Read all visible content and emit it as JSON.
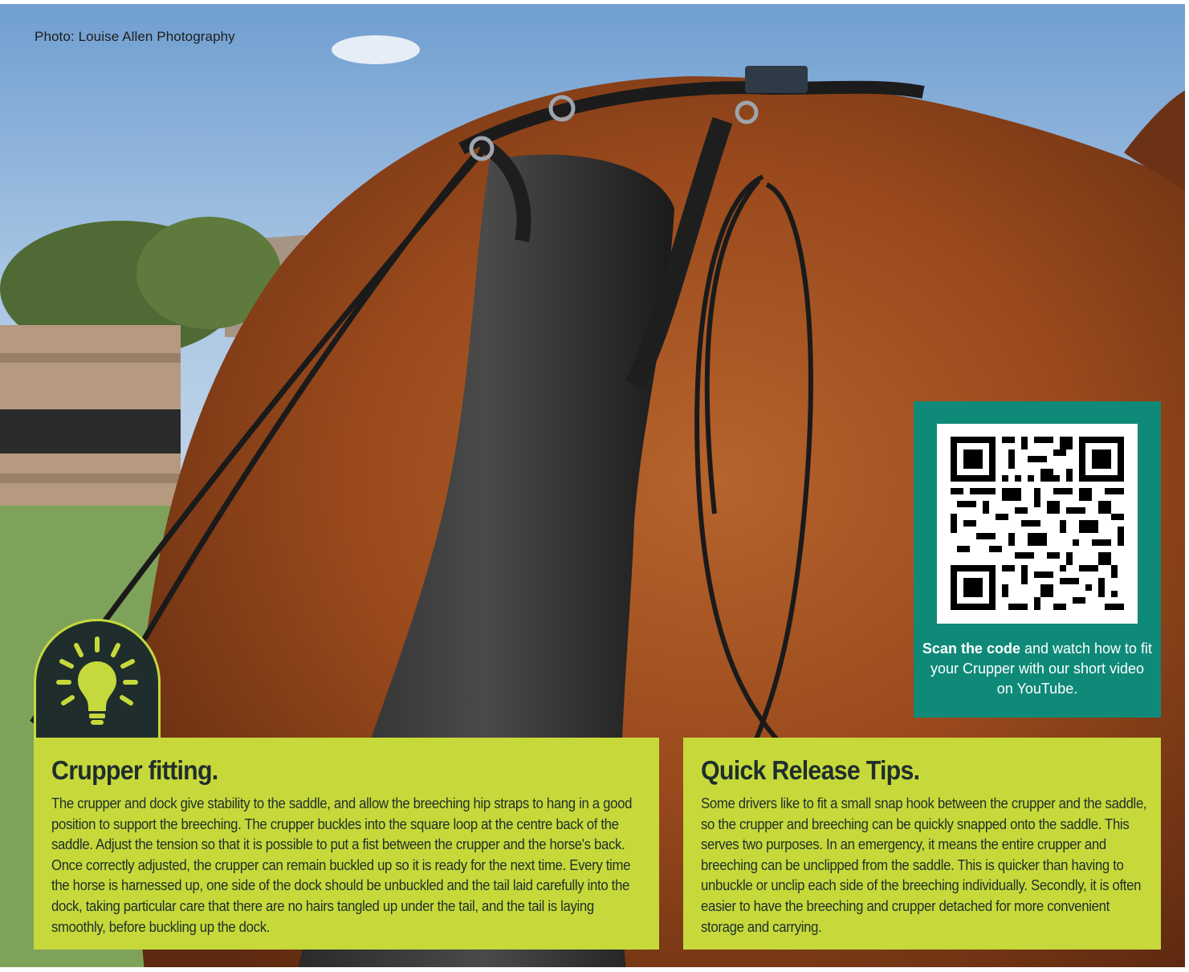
{
  "photo": {
    "credit": "Photo: Louise Allen Photography",
    "subject": "horse-hindquarters-with-crupper"
  },
  "qr_panel": {
    "caption_bold": "Scan the code",
    "caption_rest": " and watch how to fit your Crupper with our short video on YouTube.",
    "background_color": "#0f8a78"
  },
  "badge": {
    "icon": "lightbulb-icon",
    "background_color": "#1f2e2d",
    "accent_color": "#c6d93c"
  },
  "crupper_fitting": {
    "title": "Crupper fitting.",
    "body": "The crupper and dock give stability to the saddle, and allow the breeching hip straps to hang in a good position to support the breeching. The crupper buckles into the square loop at the centre back of the saddle. Adjust the tension so that it is possible to put a fist between the crupper and the horse's back. Once correctly adjusted, the crupper can remain buckled up so it is ready for the next time. Every time the horse is harnessed up, one side of the dock should be unbuckled and the tail laid carefully into the dock, taking particular care that there are no hairs tangled up under the tail, and the tail is laying smoothly, before buckling up the dock."
  },
  "quick_release": {
    "title": "Quick Release Tips.",
    "body": "Some drivers like to fit a small snap hook between the crupper and the saddle, so the crupper and breeching can be quickly snapped onto the saddle. This serves two purposes. In an emergency, it means the entire crupper and breeching can be unclipped from the saddle. This is quicker than having to unbuckle or unclip each side of the breeching individually. Secondly, it is often easier to have the breeching and crupper detached for more convenient storage and carrying."
  },
  "colors": {
    "tip_box": "#c7d93a",
    "text_dark": "#1f2e2d"
  }
}
